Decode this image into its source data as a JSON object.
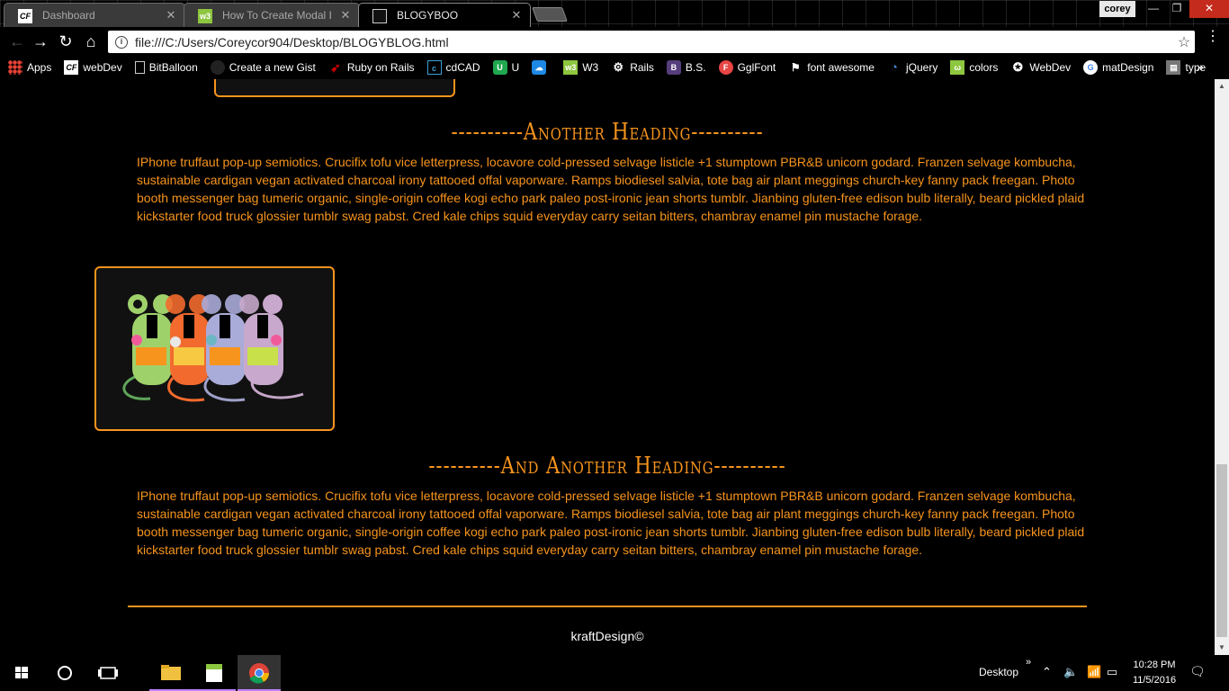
{
  "browser": {
    "tabs": [
      {
        "label": "Dashboard",
        "icon": "cf-icon"
      },
      {
        "label": "How To Create Modal I",
        "icon": "w3-icon"
      },
      {
        "label": "BLOGYBOO",
        "icon": "page-icon",
        "active": true
      }
    ],
    "profile": "corey",
    "url": "file:///C:/Users/Coreycor904/Desktop/BLOGYBLOG.html",
    "bookmarks": [
      "Apps",
      "webDev",
      "BitBalloon",
      "Create a new Gist",
      "Ruby on Rails",
      "cdCAD",
      "U",
      "",
      "W3",
      "Rails",
      "B.S.",
      "GglFont",
      "font awesome",
      "jQuery",
      "colors",
      "WebDev",
      "matDesign",
      "type"
    ]
  },
  "page": {
    "heading_1": "----------Another Heading----------",
    "paragraph_1": "IPhone truffaut pop-up semiotics. Crucifix tofu vice letterpress, locavore cold-pressed selvage listicle +1 stumptown PBR&B unicorn godard. Franzen selvage kombucha, sustainable cardigan vegan activated charcoal irony tattooed offal vaporware. Ramps biodiesel salvia, tote bag air plant meggings church-key fanny pack freegan. Photo booth messenger bag tumeric organic, single-origin coffee kogi echo park paleo post-ironic jean shorts tumblr. Jianbing gluten-free edison bulb literally, beard pickled plaid kickstarter food truck glossier tumblr swag pabst. Cred kale chips squid everyday carry seitan bitters, chambray enamel pin mustache forage.",
    "heading_2": "----------And Another Heading----------",
    "paragraph_2": "IPhone truffaut pop-up semiotics. Crucifix tofu vice letterpress, locavore cold-pressed selvage listicle +1 stumptown PBR&B unicorn godard. Franzen selvage kombucha, sustainable cardigan vegan activated charcoal irony tattooed offal vaporware. Ramps biodiesel salvia, tote bag air plant meggings church-key fanny pack freegan. Photo booth messenger bag tumeric organic, single-origin coffee kogi echo park paleo post-ironic jean shorts tumblr. Jianbing gluten-free edison bulb literally, beard pickled plaid kickstarter food truck glossier tumblr swag pabst. Cred kale chips squid everyday carry seitan bitters, chambray enamel pin mustache forage.",
    "footer": "kraftDesign©",
    "accent_color": "#f7941d",
    "image_card": "four-mice-illustration"
  },
  "taskbar": {
    "desktop_label": "Desktop",
    "time": "10:28 PM",
    "date": "11/5/2016"
  }
}
